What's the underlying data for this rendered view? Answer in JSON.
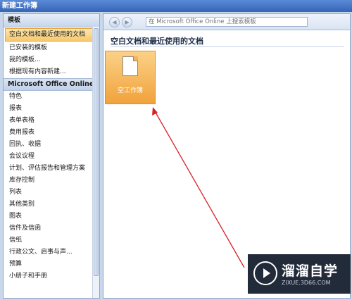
{
  "window": {
    "title": "新建工作簿"
  },
  "sidebar": {
    "heading": "模板",
    "items_top": [
      {
        "label": "空白文档和最近使用的文档",
        "selected": true
      },
      {
        "label": "已安装的模板"
      },
      {
        "label": "我的模板..."
      },
      {
        "label": "根据现有内容新建..."
      }
    ],
    "section_online": "Microsoft Office Online",
    "items_online": [
      "特色",
      "报表",
      "表单表格",
      "费用报表",
      "回执、收据",
      "会议议程",
      "计划、评估报告和管理方案",
      "库存控制",
      "列表",
      "其他类别",
      "图表",
      "信件及信函",
      "信纸",
      "行政公文、启事与声...",
      "预算",
      "小册子和手册"
    ]
  },
  "toolbar": {
    "back_glyph": "◀",
    "forward_glyph": "▶",
    "search_placeholder": "在 Microsoft Office Online 上搜索模板"
  },
  "main": {
    "section_title": "空白文档和最近使用的文档",
    "tile_label": "空工作簿"
  },
  "watermark": {
    "title": "溜溜自学",
    "subtitle": "ZIXUE.3D66.COM"
  },
  "colors": {
    "accent_orange": "#f1a23b",
    "annotation_arrow": "#d6232a"
  }
}
